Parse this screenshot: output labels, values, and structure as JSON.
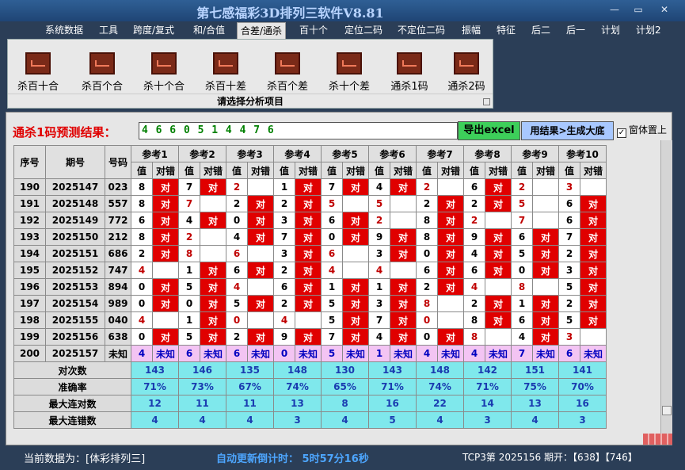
{
  "window": {
    "title": "第七感福彩3D排列三软件V8.81",
    "min": "—",
    "max": "▭",
    "close": "✕"
  },
  "menu": [
    "系统数据",
    "工具",
    "跨度/复式",
    "和/合值",
    "合差/通杀",
    "百十个",
    "定位二码",
    "不定位二码",
    "振幅",
    "特征",
    "后二",
    "后一",
    "计划",
    "计划2"
  ],
  "ribbon": {
    "buttons": [
      "杀百十合",
      "杀百个合",
      "杀十个合",
      "杀百十差",
      "杀百个差",
      "杀十个差",
      "通杀1码",
      "通杀2码"
    ],
    "group_label": "请选择分析项目",
    "icon": "chart-line-icon"
  },
  "prediction": {
    "label": "通杀1码预测结果：",
    "value": "4 6 6 0 5 1 4 4 7 6",
    "export_label": "导出excel",
    "generate_label": "用结果>生成大底",
    "ontop_label": "窗体置上",
    "ontop_checked": "✓"
  },
  "table": {
    "h_index": "序号",
    "h_period": "期号",
    "h_number": "号码",
    "refs": [
      "参考1",
      "参考2",
      "参考3",
      "参考4",
      "参考5",
      "参考6",
      "参考7",
      "参考8",
      "参考9",
      "参考10"
    ],
    "sub_val": "值",
    "sub_res": "对错",
    "rows": [
      {
        "idx": "190",
        "period": "2025147",
        "num": "023",
        "cells": [
          [
            "8",
            "对"
          ],
          [
            "7",
            "对"
          ],
          [
            "2",
            ""
          ],
          [
            "1",
            "对"
          ],
          [
            "7",
            "对"
          ],
          [
            "4",
            "对"
          ],
          [
            "2",
            ""
          ],
          [
            "6",
            "对"
          ],
          [
            "2",
            ""
          ],
          [
            "3",
            ""
          ]
        ]
      },
      {
        "idx": "191",
        "period": "2025148",
        "num": "557",
        "cells": [
          [
            "8",
            "对"
          ],
          [
            "7",
            ""
          ],
          [
            "2",
            "对"
          ],
          [
            "2",
            "对"
          ],
          [
            "5",
            ""
          ],
          [
            "5",
            ""
          ],
          [
            "2",
            "对"
          ],
          [
            "2",
            "对"
          ],
          [
            "5",
            ""
          ],
          [
            "6",
            "对"
          ]
        ]
      },
      {
        "idx": "192",
        "period": "2025149",
        "num": "772",
        "cells": [
          [
            "6",
            "对"
          ],
          [
            "4",
            "对"
          ],
          [
            "0",
            "对"
          ],
          [
            "3",
            "对"
          ],
          [
            "6",
            "对"
          ],
          [
            "2",
            ""
          ],
          [
            "8",
            "对"
          ],
          [
            "2",
            ""
          ],
          [
            "7",
            ""
          ],
          [
            "6",
            "对"
          ]
        ]
      },
      {
        "idx": "193",
        "period": "2025150",
        "num": "212",
        "cells": [
          [
            "8",
            "对"
          ],
          [
            "2",
            ""
          ],
          [
            "4",
            "对"
          ],
          [
            "7",
            "对"
          ],
          [
            "0",
            "对"
          ],
          [
            "9",
            "对"
          ],
          [
            "8",
            "对"
          ],
          [
            "9",
            "对"
          ],
          [
            "6",
            "对"
          ],
          [
            "7",
            "对"
          ]
        ]
      },
      {
        "idx": "194",
        "period": "2025151",
        "num": "686",
        "cells": [
          [
            "2",
            "对"
          ],
          [
            "8",
            ""
          ],
          [
            "6",
            ""
          ],
          [
            "3",
            "对"
          ],
          [
            "6",
            ""
          ],
          [
            "3",
            "对"
          ],
          [
            "0",
            "对"
          ],
          [
            "4",
            "对"
          ],
          [
            "5",
            "对"
          ],
          [
            "2",
            "对"
          ]
        ]
      },
      {
        "idx": "195",
        "period": "2025152",
        "num": "747",
        "cells": [
          [
            "4",
            ""
          ],
          [
            "1",
            "对"
          ],
          [
            "6",
            "对"
          ],
          [
            "2",
            "对"
          ],
          [
            "4",
            ""
          ],
          [
            "4",
            ""
          ],
          [
            "6",
            "对"
          ],
          [
            "6",
            "对"
          ],
          [
            "0",
            "对"
          ],
          [
            "3",
            "对"
          ]
        ]
      },
      {
        "idx": "196",
        "period": "2025153",
        "num": "894",
        "cells": [
          [
            "0",
            "对"
          ],
          [
            "5",
            "对"
          ],
          [
            "4",
            ""
          ],
          [
            "6",
            "对"
          ],
          [
            "1",
            "对"
          ],
          [
            "1",
            "对"
          ],
          [
            "2",
            "对"
          ],
          [
            "4",
            ""
          ],
          [
            "8",
            ""
          ],
          [
            "5",
            "对"
          ]
        ]
      },
      {
        "idx": "197",
        "period": "2025154",
        "num": "989",
        "cells": [
          [
            "0",
            "对"
          ],
          [
            "0",
            "对"
          ],
          [
            "5",
            "对"
          ],
          [
            "2",
            "对"
          ],
          [
            "5",
            "对"
          ],
          [
            "3",
            "对"
          ],
          [
            "8",
            ""
          ],
          [
            "2",
            "对"
          ],
          [
            "1",
            "对"
          ],
          [
            "2",
            "对"
          ]
        ]
      },
      {
        "idx": "198",
        "period": "2025155",
        "num": "040",
        "cells": [
          [
            "4",
            ""
          ],
          [
            "1",
            "对"
          ],
          [
            "0",
            ""
          ],
          [
            "4",
            ""
          ],
          [
            "5",
            "对"
          ],
          [
            "7",
            "对"
          ],
          [
            "0",
            ""
          ],
          [
            "8",
            "对"
          ],
          [
            "6",
            "对"
          ],
          [
            "5",
            "对"
          ]
        ]
      },
      {
        "idx": "199",
        "period": "2025156",
        "num": "638",
        "cells": [
          [
            "0",
            "对"
          ],
          [
            "5",
            "对"
          ],
          [
            "2",
            "对"
          ],
          [
            "9",
            "对"
          ],
          [
            "7",
            "对"
          ],
          [
            "4",
            "对"
          ],
          [
            "0",
            "对"
          ],
          [
            "8",
            ""
          ],
          [
            "4",
            "对"
          ],
          [
            "3",
            ""
          ]
        ]
      }
    ],
    "future": {
      "idx": "200",
      "period": "2025157",
      "num": "未知",
      "vals": [
        "4",
        "6",
        "6",
        "0",
        "5",
        "1",
        "4",
        "4",
        "7",
        "6"
      ],
      "res": "未知"
    },
    "stats": [
      {
        "label": "对次数",
        "vals": [
          "143",
          "146",
          "135",
          "148",
          "130",
          "143",
          "148",
          "142",
          "151",
          "141"
        ]
      },
      {
        "label": "准确率",
        "vals": [
          "71%",
          "73%",
          "67%",
          "74%",
          "65%",
          "71%",
          "74%",
          "71%",
          "75%",
          "70%"
        ]
      },
      {
        "label": "最大连对数",
        "vals": [
          "12",
          "11",
          "11",
          "13",
          "8",
          "16",
          "22",
          "14",
          "13",
          "16"
        ]
      },
      {
        "label": "最大连错数",
        "vals": [
          "4",
          "4",
          "4",
          "3",
          "4",
          "5",
          "4",
          "3",
          "4",
          "3"
        ]
      }
    ]
  },
  "status": {
    "current": "当前数据为：[体彩排列三]",
    "countdown": "自动更新倒计时： 5时57分16秒",
    "latest": "TCP3第 2025156 期开：【638】【746】"
  }
}
